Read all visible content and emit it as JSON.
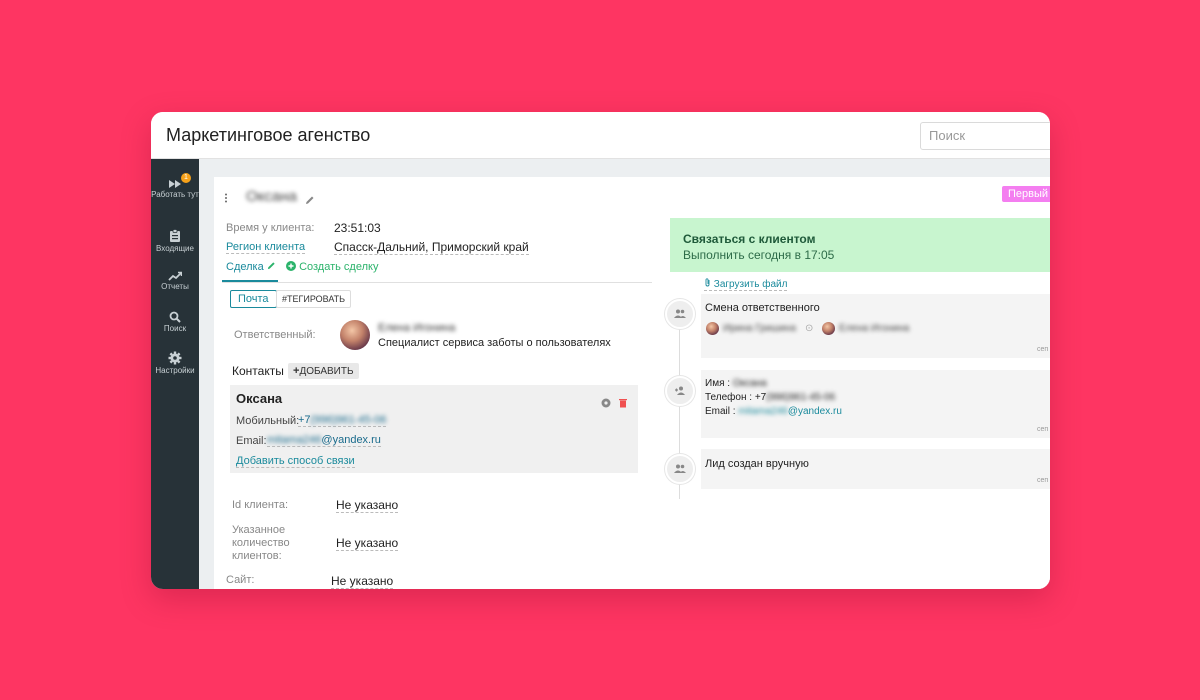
{
  "app": {
    "title": "Маркетинговое агенство"
  },
  "search": {
    "placeholder": "Поиск"
  },
  "sidebar": {
    "items": [
      {
        "label": "Работать тут",
        "icon": "fast-forward-icon",
        "badge": "1"
      },
      {
        "label": "Входящие",
        "icon": "clipboard-icon"
      },
      {
        "label": "Отчеты",
        "icon": "trending-icon"
      },
      {
        "label": "Поиск",
        "icon": "search-icon"
      },
      {
        "label": "Настройки",
        "icon": "gear-icon"
      }
    ]
  },
  "lead": {
    "name": "Оксана",
    "status_tag": "Первый контакт/Пре",
    "time_label": "Время у клиента:",
    "time_value": "23:51:03",
    "region_label": "Регион клиента",
    "region_value": "Спасск-Дальний, Приморский край"
  },
  "tabs": {
    "deal": "Сделка",
    "create_deal": "Создать сделку"
  },
  "actions": {
    "mail": "Почта",
    "tag": "#ТЕГИРОВАТЬ"
  },
  "responsible": {
    "label": "Ответственный:",
    "name": "Елена Игонина",
    "role": "Специалист сервиса заботы о пользователях"
  },
  "contacts": {
    "title": "Контакты",
    "add_label": "ДОБАВИТЬ",
    "card": {
      "name": "Оксана",
      "phone_label": "Мобильный:",
      "phone_prefix": "+7",
      "phone_hidden": "(996)961-45-06",
      "email_label": "Email:",
      "email_hidden": "mitama246",
      "email_domain": "@yandex.ru",
      "add_method": "Добавить способ связи"
    }
  },
  "fields": [
    {
      "label": "Id клиента:",
      "value": "Не указано"
    },
    {
      "label": "Указанное количество клиентов:",
      "value": "Не указано"
    },
    {
      "label": "Сайт:",
      "value": "Не указано"
    }
  ],
  "task": {
    "title": "Связаться с клиентом",
    "subtitle": "Выполнить сегодня в 17:05"
  },
  "upload_label": "Загрузить файл",
  "timeline": [
    {
      "title": "Смена ответственного",
      "from": "Ирина Гришина",
      "to": "Елена Игонина",
      "date": "сеп"
    },
    {
      "name_label": "Имя :",
      "name_value": "Оксана",
      "phone_label": "Телефон :",
      "phone_prefix": "+7",
      "phone_hidden": "(996)961-45-06",
      "email_label": "Email :",
      "email_hidden": "mitama246",
      "email_domain": "@yandex.ru",
      "date": "сеп"
    },
    {
      "title": "Лид создан вручную",
      "date": "сеп"
    }
  ],
  "colors": {
    "background": "#fe3562",
    "sidebar": "#273238",
    "accent": "#1a8a9c",
    "badge": "#f7a21a",
    "status_tag": "#f47ef0",
    "task_bg": "#c8f5cf"
  }
}
